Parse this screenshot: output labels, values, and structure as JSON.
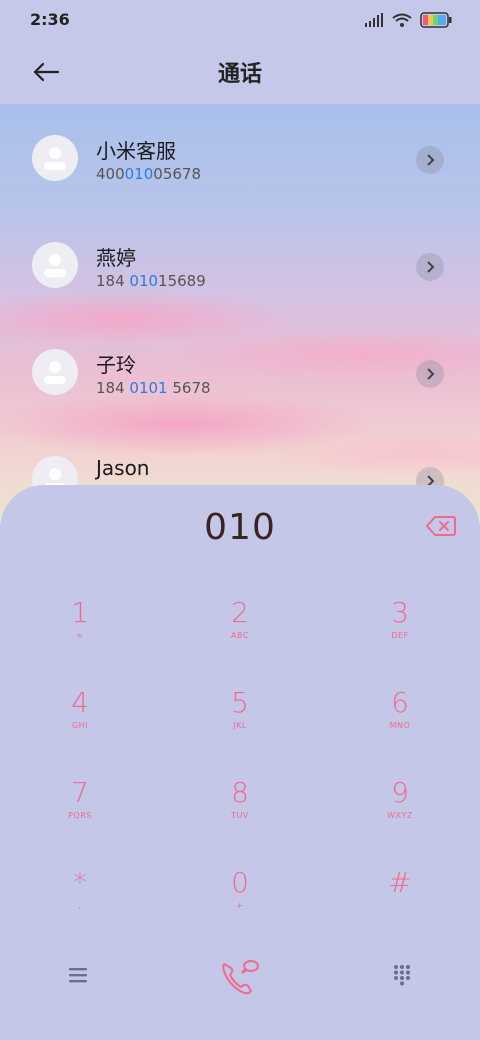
{
  "status_bar": {
    "time": "2:36"
  },
  "header": {
    "title": "通话",
    "back_icon": "arrow-left-icon"
  },
  "contacts": [
    {
      "name": "小米客服",
      "number_pre": "400",
      "number_hl": "010",
      "number_post": "05678"
    },
    {
      "name": "燕婷",
      "number_pre": "184 ",
      "number_hl": "010",
      "number_post": "15689"
    },
    {
      "name": "子玲",
      "number_pre": "184 ",
      "number_hl": "0101",
      "number_post": " 5678"
    },
    {
      "name": "Jason",
      "number_pre": "",
      "number_hl": "",
      "number_post": ""
    }
  ],
  "dialer": {
    "input": "010",
    "keys": [
      {
        "digit": "1",
        "letters": "∞"
      },
      {
        "digit": "2",
        "letters": "ABC"
      },
      {
        "digit": "3",
        "letters": "DEF"
      },
      {
        "digit": "4",
        "letters": "GHI"
      },
      {
        "digit": "5",
        "letters": "JKL"
      },
      {
        "digit": "6",
        "letters": "MNO"
      },
      {
        "digit": "7",
        "letters": "PQRS"
      },
      {
        "digit": "8",
        "letters": "TUV"
      },
      {
        "digit": "9",
        "letters": "WXYZ"
      },
      {
        "digit": "*",
        "letters": ","
      },
      {
        "digit": "0",
        "letters": "+"
      },
      {
        "digit": "#",
        "letters": ""
      }
    ]
  },
  "colors": {
    "accent": "#f06a8e",
    "highlight": "#2a7de0",
    "panel": "#c4c7e8"
  }
}
